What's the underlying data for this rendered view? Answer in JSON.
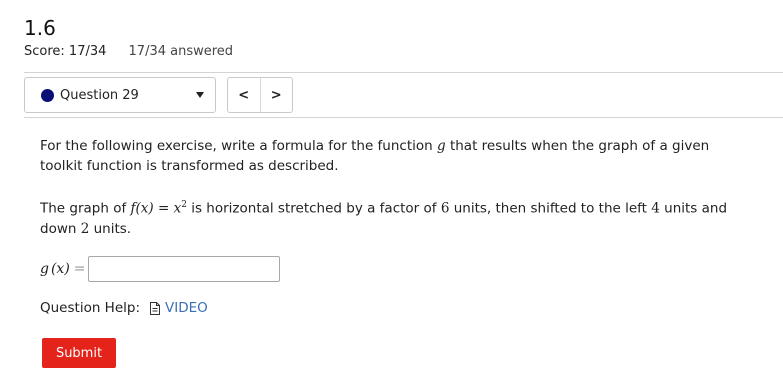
{
  "header": {
    "title": "1.6",
    "score": "Score: 17/34",
    "answered": "17/34 answered"
  },
  "question_nav": {
    "selected": "Question 29",
    "status_color": "#0a0f75",
    "prev_label": "<",
    "next_label": ">"
  },
  "problem": {
    "intro_1": "For the following exercise, write a formula for the function ",
    "intro_var": "g",
    "intro_2": " that results when the graph of a given toolkit function is transformed as described.",
    "s1": "The graph of ",
    "fx_f": "f",
    "fx_arg": "(x)",
    "fx_eq": " = ",
    "fx_base": "x",
    "fx_exp": "2",
    "s2": " is horizontal stretched by a factor of ",
    "n1": "6",
    "s3": " units, then shifted to the left ",
    "n2": "4",
    "s4": " units and down ",
    "n3": "2",
    "s5": " units."
  },
  "answer": {
    "label_g": "g",
    "label_arg": "(x)",
    "eq": "=",
    "value": ""
  },
  "help": {
    "label": "Question Help:",
    "video": "VIDEO"
  },
  "submit_label": "Submit",
  "colors": {
    "submit": "#e4231a",
    "link": "#3b6fb6"
  }
}
